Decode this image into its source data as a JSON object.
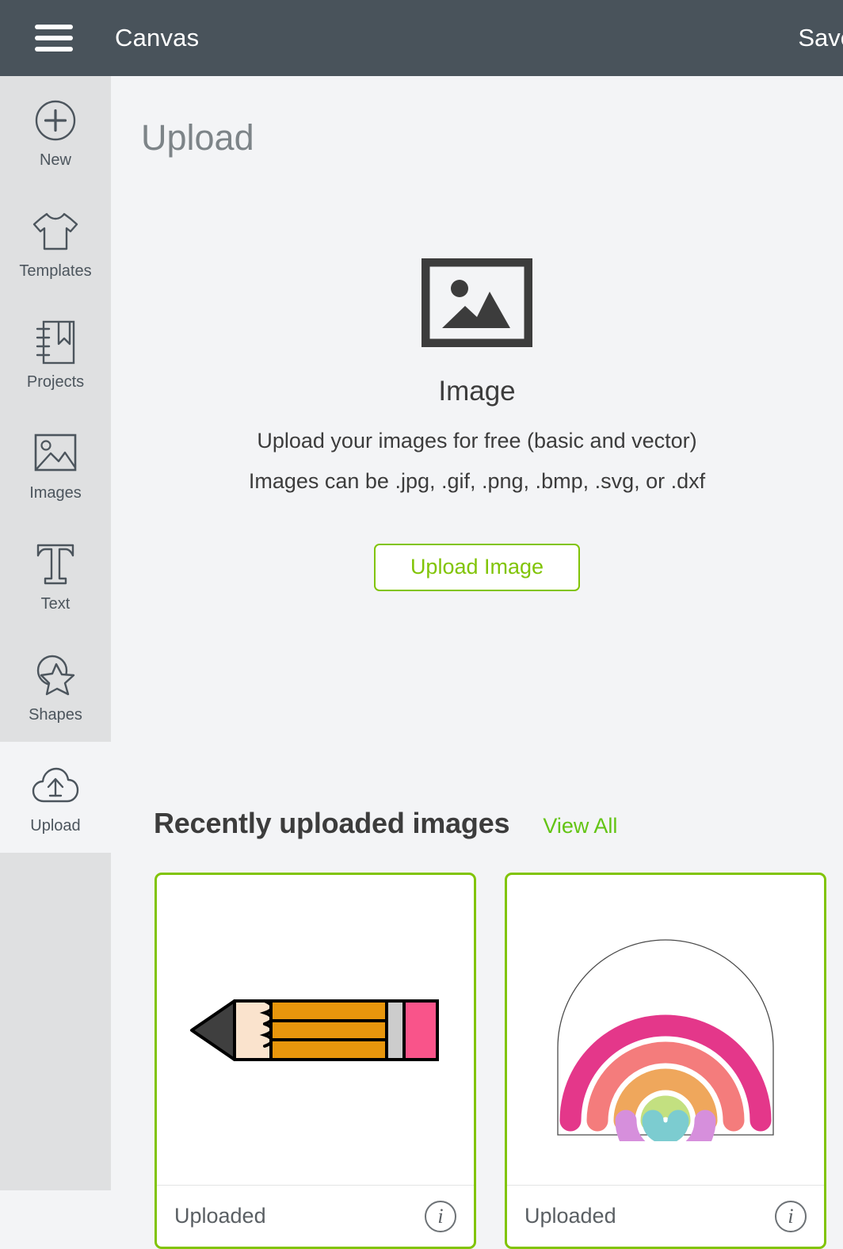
{
  "header": {
    "title": "Canvas",
    "menu_icon": "hamburger-menu-icon",
    "right_action_label": "Save"
  },
  "sidebar": {
    "items": [
      {
        "label": "New",
        "icon": "plus-circle-icon",
        "selected": false
      },
      {
        "label": "Templates",
        "icon": "tshirt-icon",
        "selected": false
      },
      {
        "label": "Projects",
        "icon": "notebook-icon",
        "selected": false
      },
      {
        "label": "Images",
        "icon": "image-icon",
        "selected": false
      },
      {
        "label": "Text",
        "icon": "text-t-icon",
        "selected": false
      },
      {
        "label": "Shapes",
        "icon": "shapes-star-icon",
        "selected": false
      },
      {
        "label": "Upload",
        "icon": "cloud-upload-icon",
        "selected": true
      }
    ]
  },
  "main": {
    "page_title": "Upload",
    "upload_panel": {
      "icon": "picture-frame-icon",
      "heading": "Image",
      "line1": "Upload your images for free (basic and vector)",
      "line2": "Images can be .jpg, .gif, .png, .bmp, .svg, or .dxf",
      "button_label": "Upload Image"
    },
    "recent": {
      "title": "Recently uploaded images",
      "view_all_label": "View All",
      "cards": [
        {
          "art": "pencil",
          "status": "Uploaded",
          "info_icon": "info-circle-icon"
        },
        {
          "art": "rainbow",
          "status": "Uploaded",
          "info_icon": "info-circle-icon"
        }
      ]
    }
  },
  "colors": {
    "header_bg": "#49535b",
    "sidebar_bg": "#dfe0e1",
    "sidebar_selected_bg": "#f3f4f6",
    "content_bg": "#f3f4f6",
    "accent_green": "#81c406",
    "link_green": "#63c414",
    "text_dark": "#3c3c3c",
    "title_gray": "#7d8488",
    "pencil_body": "#e8960c",
    "pencil_ferrule": "#cccccc",
    "pencil_eraser": "#f9548a",
    "pencil_wood": "#fae3cd",
    "pencil_tip": "#3f3f3f",
    "rainbow_band_1": "#e4378a",
    "rainbow_band_2": "#f47c7c",
    "rainbow_band_3": "#efa75c",
    "rainbow_band_4": "#c3e080",
    "rainbow_band_5": "#7cccd0",
    "rainbow_band_6": "#d68fdc"
  }
}
